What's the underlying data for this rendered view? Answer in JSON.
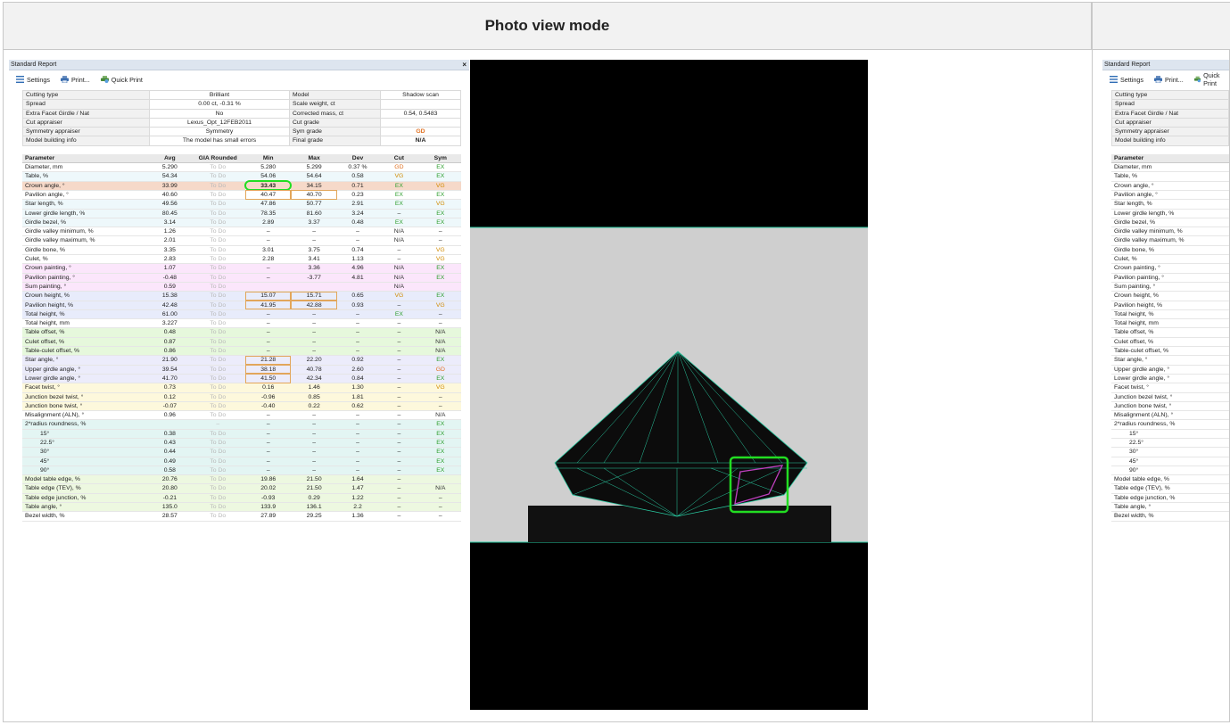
{
  "header": {
    "title": "Photo view mode"
  },
  "report": {
    "title": "Standard Report",
    "close": "×",
    "toolbar": {
      "settings": "Settings",
      "print": "Print...",
      "quick_print": "Quick Print"
    },
    "info": [
      {
        "k1": "Cutting type",
        "v1": "Brilliant",
        "k2": "Model",
        "v2": "Shadow scan",
        "c2": ""
      },
      {
        "k1": "Spread",
        "v1": "0.00 ct, -0.31 %",
        "k2": "Scale weight, ct",
        "v2": "",
        "c2": ""
      },
      {
        "k1": "Extra Facet Girdle / Nat",
        "v1": "No",
        "k2": "Corrected mass, ct",
        "v2": "0.54, 0.5483",
        "c2": ""
      },
      {
        "k1": "Cut appraiser",
        "v1": "Lexus_Opt_12FEB2011",
        "k2": "Cut grade",
        "v2": "",
        "c2": ""
      },
      {
        "k1": "Symmetry appraiser",
        "v1": "Symmetry",
        "k2": "Sym grade",
        "v2": "GD",
        "c2": "#e07020"
      },
      {
        "k1": "Model building info",
        "v1": "The model has small errors",
        "k2": "Final grade",
        "v2": "N/A",
        "c2": "#222"
      }
    ],
    "columns": [
      "Parameter",
      "Avg",
      "GIA Rounded",
      "Min",
      "Max",
      "Dev",
      "Cut",
      "Sym"
    ],
    "rows": [
      {
        "p": "Diameter, mm",
        "avg": "5.290",
        "gia": "To Do",
        "min": "5.280",
        "max": "5.299",
        "dev": "0.37 %",
        "cut": "GD",
        "sym": "EX",
        "bg": "#ffffff"
      },
      {
        "p": "Table, %",
        "avg": "54.34",
        "gia": "To Do",
        "min": "54.06",
        "max": "54.64",
        "dev": "0.58",
        "cut": "VG",
        "sym": "EX",
        "bg": "#eef8fb"
      },
      {
        "p": "Crown angle, °",
        "avg": "33.99",
        "gia": "To Do",
        "min": "33.43",
        "max": "34.15",
        "dev": "0.71",
        "cut": "EX",
        "sym": "VG",
        "bg": "#f6d9c9"
      },
      {
        "p": "Pavilion angle, °",
        "avg": "40.60",
        "gia": "To Do",
        "min": "40.47",
        "max": "40.70",
        "dev": "0.23",
        "cut": "EX",
        "sym": "EX",
        "bg": "#ffffff"
      },
      {
        "p": "Star length, %",
        "avg": "49.56",
        "gia": "To Do",
        "min": "47.86",
        "max": "50.77",
        "dev": "2.91",
        "cut": "EX",
        "sym": "VG",
        "bg": "#eef8fb"
      },
      {
        "p": "Lower girdle length, %",
        "avg": "80.45",
        "gia": "To Do",
        "min": "78.35",
        "max": "81.60",
        "dev": "3.24",
        "cut": "–",
        "sym": "EX",
        "bg": "#eef8fb"
      },
      {
        "p": "Girdle bezel, %",
        "avg": "3.14",
        "gia": "To Do",
        "min": "2.89",
        "max": "3.37",
        "dev": "0.48",
        "cut": "EX",
        "sym": "EX",
        "bg": "#eef8fb"
      },
      {
        "p": "Girdle valley minimum, %",
        "avg": "1.26",
        "gia": "To Do",
        "min": "–",
        "max": "–",
        "dev": "–",
        "cut": "N/A",
        "sym": "–",
        "bg": "#ffffff"
      },
      {
        "p": "Girdle valley maximum, %",
        "avg": "2.01",
        "gia": "To Do",
        "min": "–",
        "max": "–",
        "dev": "–",
        "cut": "N/A",
        "sym": "–",
        "bg": "#ffffff"
      },
      {
        "p": "Girdle bone, %",
        "avg": "3.35",
        "gia": "To Do",
        "min": "3.01",
        "max": "3.75",
        "dev": "0.74",
        "cut": "–",
        "sym": "VG",
        "bg": "#ffffff"
      },
      {
        "p": "Culet, %",
        "avg": "2.83",
        "gia": "To Do",
        "min": "2.28",
        "max": "3.41",
        "dev": "1.13",
        "cut": "–",
        "sym": "VG",
        "bg": "#ffffff"
      },
      {
        "p": "Crown painting, °",
        "avg": "1.07",
        "gia": "To Do",
        "min": "–",
        "max": "3.36",
        "dev": "4.96",
        "cut": "N/A",
        "sym": "EX",
        "bg": "#fbe6fb"
      },
      {
        "p": "Pavilion painting, °",
        "avg": "-0.48",
        "gia": "To Do",
        "min": "–",
        "max": "-3.77",
        "dev": "4.81",
        "cut": "N/A",
        "sym": "EX",
        "bg": "#fbe6fb"
      },
      {
        "p": "Sum painting, °",
        "avg": "0.59",
        "gia": "To Do",
        "min": "",
        "max": "",
        "dev": "",
        "cut": "N/A",
        "sym": "",
        "bg": "#fbe6fb"
      },
      {
        "p": "Crown height, %",
        "avg": "15.38",
        "gia": "To Do",
        "min": "15.07",
        "max": "15.71",
        "dev": "0.65",
        "cut": "VG",
        "sym": "EX",
        "bg": "#e8ecfb"
      },
      {
        "p": "Pavilion height, %",
        "avg": "42.48",
        "gia": "To Do",
        "min": "41.95",
        "max": "42.88",
        "dev": "0.93",
        "cut": "–",
        "sym": "VG",
        "bg": "#e8ecfb"
      },
      {
        "p": "Total height, %",
        "avg": "61.00",
        "gia": "To Do",
        "min": "–",
        "max": "–",
        "dev": "–",
        "cut": "EX",
        "sym": "–",
        "bg": "#e8ecfb"
      },
      {
        "p": "Total height, mm",
        "avg": "3.227",
        "gia": "To Do",
        "min": "–",
        "max": "–",
        "dev": "–",
        "cut": "–",
        "sym": "–",
        "bg": "#ffffff"
      },
      {
        "p": "Table offset, %",
        "avg": "0.48",
        "gia": "To Do",
        "min": "–",
        "max": "–",
        "dev": "–",
        "cut": "–",
        "sym": "N/A",
        "bg": "#e6f8dc"
      },
      {
        "p": "Culet offset, %",
        "avg": "0.87",
        "gia": "To Do",
        "min": "–",
        "max": "–",
        "dev": "–",
        "cut": "–",
        "sym": "N/A",
        "bg": "#e6f8dc"
      },
      {
        "p": "Table-culet offset, %",
        "avg": "0.86",
        "gia": "To Do",
        "min": "–",
        "max": "–",
        "dev": "–",
        "cut": "–",
        "sym": "N/A",
        "bg": "#e6f8dc"
      },
      {
        "p": "Star angle, °",
        "avg": "21.90",
        "gia": "To Do",
        "min": "21.28",
        "max": "22.20",
        "dev": "0.92",
        "cut": "–",
        "sym": "EX",
        "bg": "#ececfb"
      },
      {
        "p": "Upper girdle angle, °",
        "avg": "39.54",
        "gia": "To Do",
        "min": "38.18",
        "max": "40.78",
        "dev": "2.60",
        "cut": "–",
        "sym": "GD",
        "bg": "#ececfb"
      },
      {
        "p": "Lower girdle angle, °",
        "avg": "41.70",
        "gia": "To Do",
        "min": "41.50",
        "max": "42.34",
        "dev": "0.84",
        "cut": "–",
        "sym": "EX",
        "bg": "#ececfb"
      },
      {
        "p": "Facet twist, °",
        "avg": "0.73",
        "gia": "To Do",
        "min": "0.16",
        "max": "1.46",
        "dev": "1.30",
        "cut": "–",
        "sym": "VG",
        "bg": "#fdf8dc"
      },
      {
        "p": "Junction bezel twist, °",
        "avg": "0.12",
        "gia": "To Do",
        "min": "-0.96",
        "max": "0.85",
        "dev": "1.81",
        "cut": "–",
        "sym": "–",
        "bg": "#fdf8dc"
      },
      {
        "p": "Junction bone twist, °",
        "avg": "-0.07",
        "gia": "To Do",
        "min": "-0.40",
        "max": "0.22",
        "dev": "0.62",
        "cut": "–",
        "sym": "–",
        "bg": "#fdf8dc"
      },
      {
        "p": "Misalignment (ALN), °",
        "avg": "0.96",
        "gia": "To Do",
        "min": "–",
        "max": "–",
        "dev": "–",
        "cut": "–",
        "sym": "N/A",
        "bg": "#ffffff"
      },
      {
        "p": "2*radius roundness, %",
        "avg": "",
        "gia": "–",
        "min": "–",
        "max": "–",
        "dev": "–",
        "cut": "–",
        "sym": "EX",
        "bg": "#e3f5f3"
      },
      {
        "p": "15°",
        "avg": "0.38",
        "gia": "To Do",
        "min": "–",
        "max": "–",
        "dev": "–",
        "cut": "–",
        "sym": "EX",
        "bg": "#e3f5f3",
        "indent": true
      },
      {
        "p": "22.5°",
        "avg": "0.43",
        "gia": "To Do",
        "min": "–",
        "max": "–",
        "dev": "–",
        "cut": "–",
        "sym": "EX",
        "bg": "#e3f5f3",
        "indent": true
      },
      {
        "p": "30°",
        "avg": "0.44",
        "gia": "To Do",
        "min": "–",
        "max": "–",
        "dev": "–",
        "cut": "–",
        "sym": "EX",
        "bg": "#e3f5f3",
        "indent": true
      },
      {
        "p": "45°",
        "avg": "0.49",
        "gia": "To Do",
        "min": "–",
        "max": "–",
        "dev": "–",
        "cut": "–",
        "sym": "EX",
        "bg": "#e3f5f3",
        "indent": true
      },
      {
        "p": "90°",
        "avg": "0.58",
        "gia": "To Do",
        "min": "–",
        "max": "–",
        "dev": "–",
        "cut": "–",
        "sym": "EX",
        "bg": "#e3f5f3",
        "indent": true
      },
      {
        "p": "Model table edge, %",
        "avg": "20.76",
        "gia": "To Do",
        "min": "19.86",
        "max": "21.50",
        "dev": "1.64",
        "cut": "–",
        "sym": "",
        "bg": "#edf8e0"
      },
      {
        "p": "Table edge (TEV), %",
        "avg": "20.80",
        "gia": "To Do",
        "min": "20.02",
        "max": "21.50",
        "dev": "1.47",
        "cut": "–",
        "sym": "N/A",
        "bg": "#edf8e0"
      },
      {
        "p": "Table edge junction, %",
        "avg": "-0.21",
        "gia": "To Do",
        "min": "-0.93",
        "max": "0.29",
        "dev": "1.22",
        "cut": "–",
        "sym": "–",
        "bg": "#edf8e0"
      },
      {
        "p": "Table angle, °",
        "avg": "135.0",
        "gia": "To Do",
        "min": "133.9",
        "max": "136.1",
        "dev": "2.2",
        "cut": "–",
        "sym": "–",
        "bg": "#edf8e0"
      },
      {
        "p": "Bezel width, %",
        "avg": "28.57",
        "gia": "To Do",
        "min": "27.89",
        "max": "29.25",
        "dev": "1.36",
        "cut": "–",
        "sym": "–",
        "bg": "#ffffff"
      }
    ]
  },
  "grade_colors": {
    "EX": "#2e9e2e",
    "VG": "#d08a00",
    "GD": "#e07020",
    "N/A": "#333333"
  },
  "photo": {
    "background": "#000000",
    "stage": "#cfcfcf",
    "wire_color": "#29c9a0",
    "highlight_color": "#22dd22",
    "facet_color": "#c040c0"
  }
}
